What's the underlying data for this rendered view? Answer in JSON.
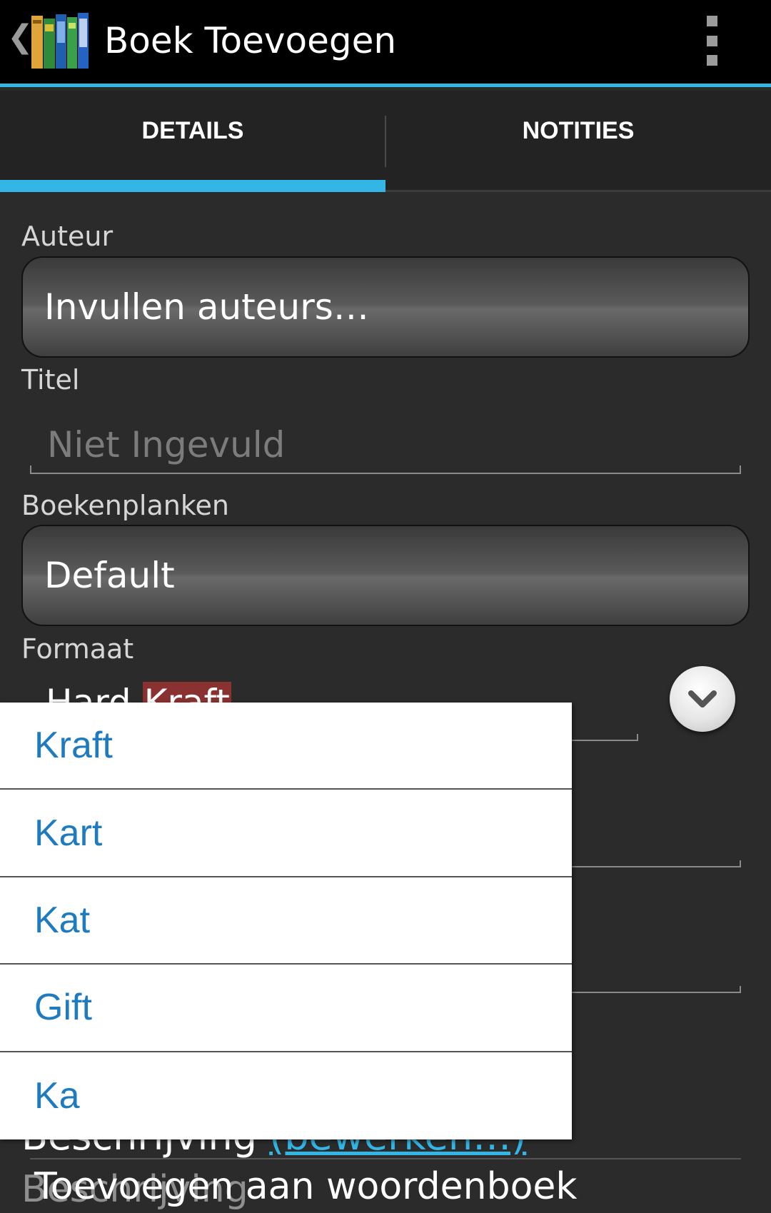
{
  "action_bar": {
    "title": "Boek Toevoegen",
    "icons": {
      "back": "chevron-left-icon",
      "app": "books-icon",
      "menu": "overflow-menu-icon"
    }
  },
  "tabs": [
    {
      "label": "DETAILS",
      "selected": true
    },
    {
      "label": "NOTITIES",
      "selected": false
    }
  ],
  "form": {
    "author": {
      "label": "Auteur",
      "value": "Invullen auteurs…"
    },
    "title": {
      "label": "Titel",
      "placeholder": "Niet Ingevuld"
    },
    "bookshelves": {
      "label": "Boekenplanken",
      "value": "Default"
    },
    "format": {
      "label": "Formaat",
      "value_prefix": "Hard",
      "value_highlight": "Kraft"
    },
    "description": {
      "label": "Beschrijving",
      "edit_link": "(bewerken…)",
      "placeholder": "Beschrijving"
    }
  },
  "autocomplete": {
    "suggestions": [
      "Kraft",
      "Kart",
      "Kat",
      "Gift",
      "Ka"
    ],
    "dictionary_hint": "Toevoegen aan woordenboek"
  },
  "colors": {
    "accent": "#33b5e5",
    "suggestion_text": "#1e7bbf",
    "highlight": "#8a3232"
  }
}
